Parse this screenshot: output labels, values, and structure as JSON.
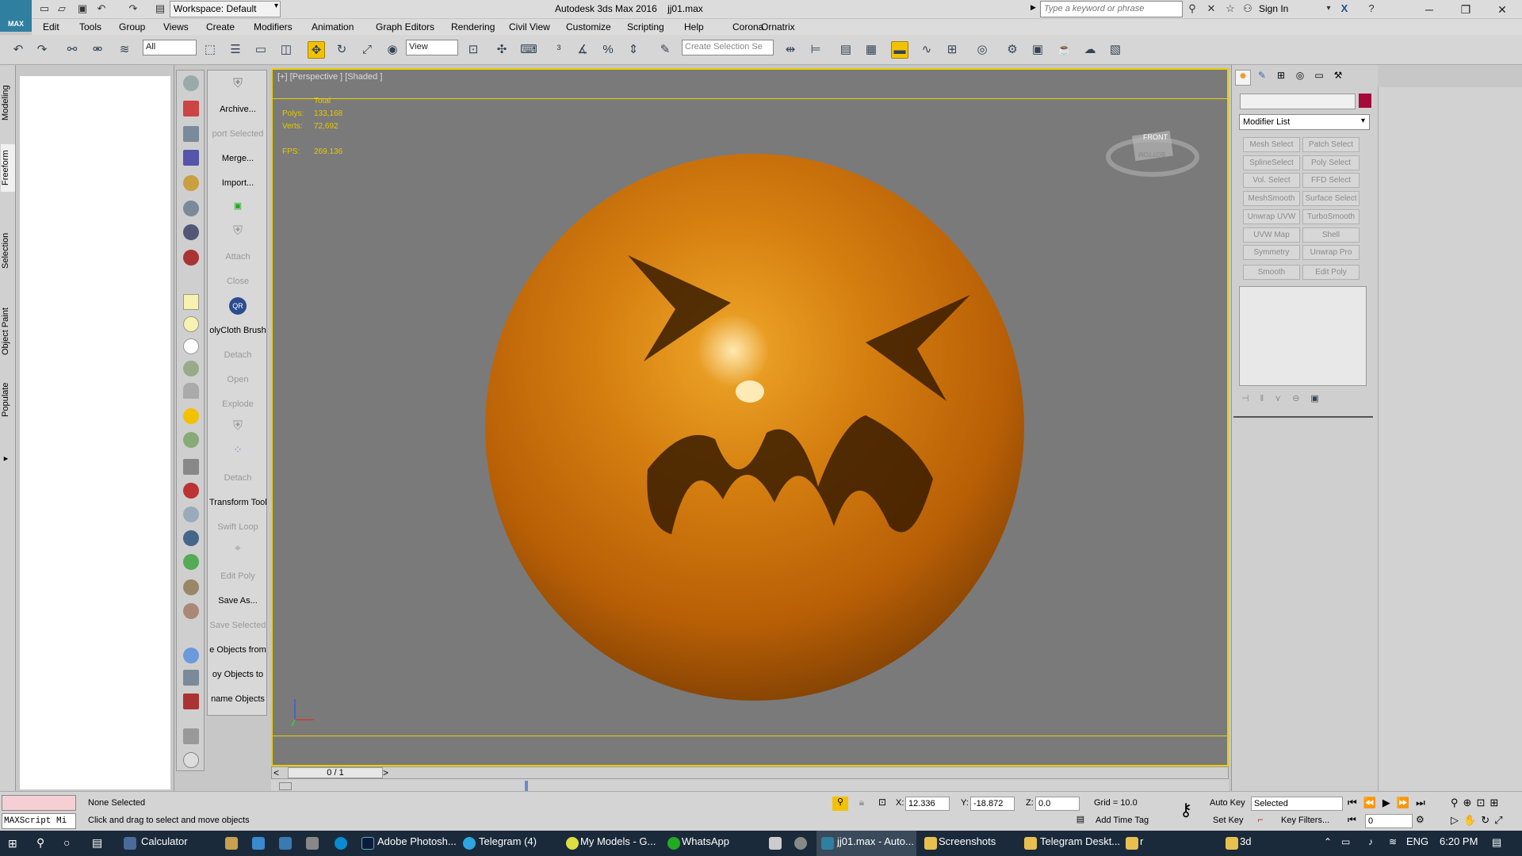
{
  "titlebar": {
    "workspace": "Workspace: Default",
    "app_title": "Autodesk 3ds Max 2016",
    "file_name": "jj01.max",
    "search_placeholder": "Type a keyword or phrase",
    "sign_in": "Sign In",
    "logo_text": "MAX"
  },
  "menu": [
    "Edit",
    "Tools",
    "Group",
    "Views",
    "Create",
    "Modifiers",
    "Animation",
    "Graph Editors",
    "Rendering",
    "Civil View",
    "Customize",
    "Scripting",
    "Help",
    "Corona",
    "Ornatrix"
  ],
  "toolbar": {
    "filter_value": "All",
    "refcoord_value": "View",
    "selection_set_placeholder": "Create Selection Se"
  },
  "ribbon_tabs": [
    "Modeling",
    "Freeform",
    "Selection",
    "Object Paint",
    "Populate"
  ],
  "script_buttons": [
    {
      "label": "Archive...",
      "dim": false
    },
    {
      "label": "port Selected",
      "dim": true
    },
    {
      "label": "Merge...",
      "dim": false
    },
    {
      "label": "Import...",
      "dim": false
    },
    {
      "label": "Attach",
      "dim": true
    },
    {
      "label": "Close",
      "dim": true
    },
    {
      "label": "QR",
      "dim": false
    },
    {
      "label": "olyCloth Brush",
      "dim": false
    },
    {
      "label": "Detach",
      "dim": true
    },
    {
      "label": "Open",
      "dim": true
    },
    {
      "label": "Explode",
      "dim": true
    },
    {
      "label": "Detach",
      "dim": true
    },
    {
      "label": "Transform Tool",
      "dim": false
    },
    {
      "label": "Swift Loop",
      "dim": true
    },
    {
      "label": "Edit Poly",
      "dim": true
    },
    {
      "label": "Save As...",
      "dim": false
    },
    {
      "label": "Save Selected",
      "dim": true
    },
    {
      "label": "e Objects from",
      "dim": false
    },
    {
      "label": "oy Objects to",
      "dim": false
    },
    {
      "label": "name Objects",
      "dim": false
    }
  ],
  "viewport": {
    "label": "[+] [Perspective ] [Shaded ]",
    "stats": {
      "total": "Total",
      "polys_label": "Polys:",
      "polys": "133,168",
      "verts_label": "Verts:",
      "verts": "72,692",
      "fps_label": "FPS:",
      "fps": "269.136"
    },
    "viewcube_front": "FRONT",
    "viewcube_bottom": "BOTTOM"
  },
  "time_slider": {
    "value": "0 / 1",
    "prev": "<",
    "next": ">"
  },
  "command_panel": {
    "modifier_list": "Modifier List",
    "modifiers": [
      "Mesh Select",
      "Patch Select",
      "SplineSelect",
      "Poly Select",
      "Vol. Select",
      "FFD Select",
      "MeshSmooth",
      "Surface Select",
      "Unwrap UVW",
      "TurboSmooth",
      "UVW Map",
      "Shell",
      "Symmetry",
      "Unwrap Pro",
      "Smooth",
      "Edit Poly"
    ]
  },
  "status": {
    "maxscript": "MAXScript Mi",
    "selection": "None Selected",
    "prompt": "Click and drag to select and move objects",
    "x_label": "X:",
    "x": "12.336",
    "y_label": "Y:",
    "y": "-18.872",
    "z_label": "Z:",
    "z": "0.0",
    "grid": "Grid = 10.0",
    "add_time_tag": "Add Time Tag",
    "auto_key": "Auto Key",
    "set_key": "Set Key",
    "key_mode": "Selected",
    "key_filters": "Key Filters...",
    "frame": "0"
  },
  "taskbar": {
    "items": [
      "Calculator",
      "Adobe Photosh...",
      "Telegram (4)",
      "My Models - G...",
      "WhatsApp",
      "jj01.max - Auto...",
      "Screenshots",
      "Telegram Deskt...",
      "r",
      "3d"
    ],
    "lang": "ENG",
    "time": "6:20 PM"
  },
  "colors": {
    "accent": "#f2c200",
    "viewport_border": "#e8d000",
    "face": "#d47e10",
    "swatch": "#a50b3a"
  }
}
